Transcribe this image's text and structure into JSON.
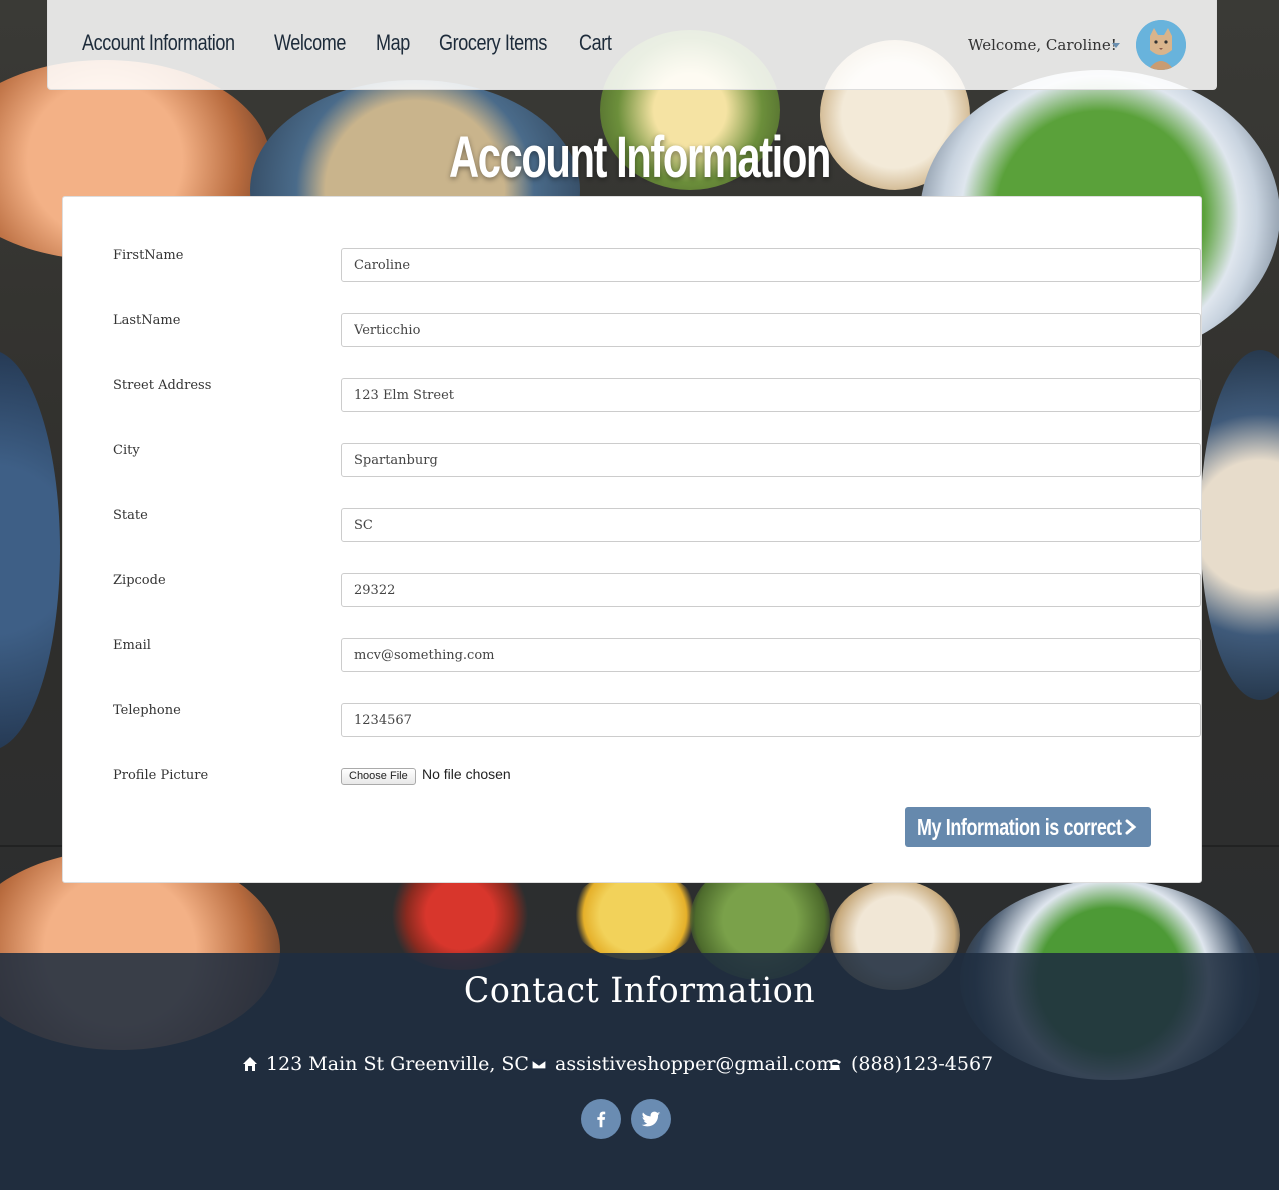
{
  "nav": {
    "links": [
      "Account Information",
      "Welcome",
      "Map",
      "Grocery Items",
      "Cart"
    ],
    "welcome_text": "Welcome, Caroline!"
  },
  "page_title": "Account Information",
  "form": {
    "fields": [
      {
        "label": "FirstName",
        "value": "Caroline"
      },
      {
        "label": "LastName",
        "value": "Verticchio"
      },
      {
        "label": "Street Address",
        "value": "123 Elm Street"
      },
      {
        "label": "City",
        "value": "Spartanburg"
      },
      {
        "label": "State",
        "value": "SC"
      },
      {
        "label": "Zipcode",
        "value": "29322"
      },
      {
        "label": "Email",
        "value": "mcv@something.com"
      },
      {
        "label": "Telephone",
        "value": "1234567"
      }
    ],
    "profile_picture_label": "Profile Picture",
    "choose_file_label": "Choose File",
    "file_status": "No file chosen",
    "submit_label": "My Information is correct"
  },
  "footer": {
    "title": "Contact Information",
    "address": "123 Main St Greenville, SC",
    "email": "assistiveshopper@gmail.com",
    "phone": "(888)123-4567",
    "social_icons": [
      "facebook-icon",
      "twitter-icon"
    ]
  },
  "colors": {
    "accent": "#6689ad",
    "footer_bg": "#1f2d40",
    "nav_text": "#1d2b3a"
  }
}
